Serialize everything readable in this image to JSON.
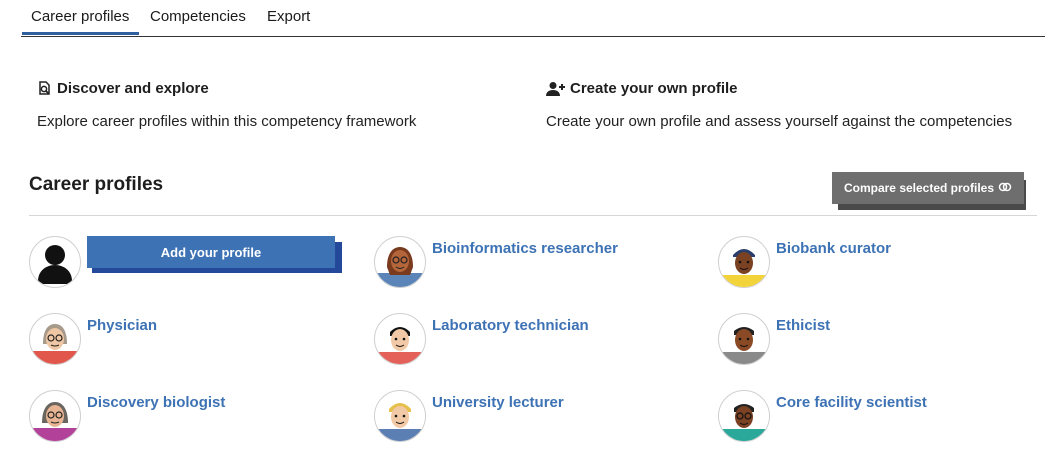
{
  "tabs": [
    {
      "label": "Career profiles",
      "active": true
    },
    {
      "label": "Competencies",
      "active": false
    },
    {
      "label": "Export",
      "active": false
    }
  ],
  "intro": {
    "discover": {
      "title": "Discover and explore",
      "text": "Explore career profiles within this competency framework",
      "icon": "search-document-icon"
    },
    "create": {
      "title": "Create your own profile",
      "text": "Create your own profile and assess yourself against the competencies",
      "icon": "add-user-icon"
    }
  },
  "section": {
    "title": "Career profiles",
    "compare_label": "Compare selected profiles"
  },
  "add_profile": {
    "label": "Add your profile"
  },
  "profiles": [
    {
      "name": "Bioinformatics researcher"
    },
    {
      "name": "Biobank curator"
    },
    {
      "name": "Physician"
    },
    {
      "name": "Laboratory technician"
    },
    {
      "name": "Ethicist"
    },
    {
      "name": "Discovery biologist"
    },
    {
      "name": "University lecturer"
    },
    {
      "name": "Core facility scientist"
    }
  ],
  "colors": {
    "accent": "#3d72b4",
    "accent_dark": "#24489a",
    "compare_bg": "#6e6e6e",
    "tab_underline": "#2f5f9e"
  }
}
